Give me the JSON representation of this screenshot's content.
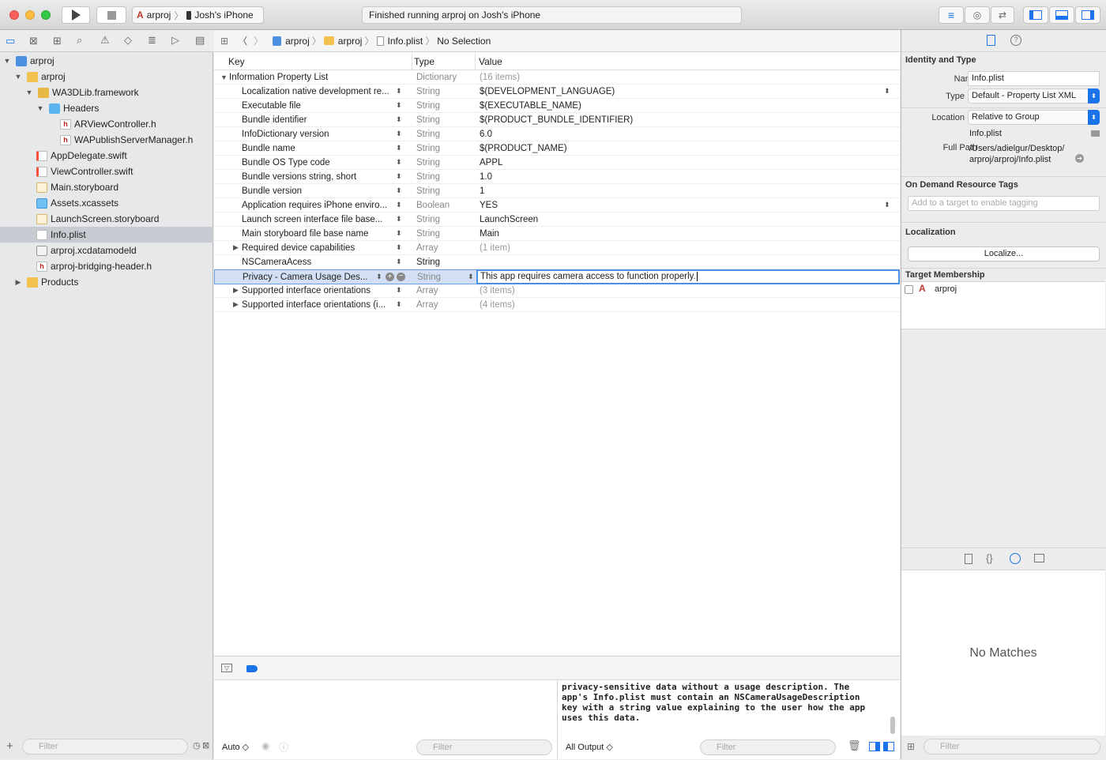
{
  "window": {
    "scheme_app": "arproj",
    "scheme_device": "Josh's iPhone",
    "status": "Finished running arproj on Josh's iPhone"
  },
  "navigator": {
    "items": [
      {
        "label": "arproj",
        "icon": "project-icon"
      },
      {
        "label": "arproj",
        "icon": "folder-icon"
      },
      {
        "label": "WA3DLib.framework",
        "icon": "framework-icon"
      },
      {
        "label": "Headers",
        "icon": "folder-icon"
      },
      {
        "label": "ARViewController.h",
        "icon": "header-file-icon"
      },
      {
        "label": "WAPublishServerManager.h",
        "icon": "header-file-icon"
      },
      {
        "label": "AppDelegate.swift",
        "icon": "swift-file-icon"
      },
      {
        "label": "ViewController.swift",
        "icon": "swift-file-icon"
      },
      {
        "label": "Main.storyboard",
        "icon": "storyboard-icon"
      },
      {
        "label": "Assets.xcassets",
        "icon": "assets-icon"
      },
      {
        "label": "LaunchScreen.storyboard",
        "icon": "storyboard-icon"
      },
      {
        "label": "Info.plist",
        "icon": "plist-icon"
      },
      {
        "label": "arproj.xcdatamodeld",
        "icon": "datamodel-icon"
      },
      {
        "label": "arproj-bridging-header.h",
        "icon": "header-file-icon"
      },
      {
        "label": "Products",
        "icon": "folder-icon"
      }
    ],
    "filter_placeholder": "Filter"
  },
  "jumpbar": {
    "p1": "arproj",
    "p2": "arproj",
    "p3": "Info.plist",
    "p4": "No Selection"
  },
  "plist": {
    "col_key": "Key",
    "col_type": "Type",
    "col_value": "Value",
    "root": {
      "key": "Information Property List",
      "type": "Dictionary",
      "value": "(16 items)"
    },
    "rows": [
      {
        "key": "Localization native development re...",
        "type": "String",
        "value": "$(DEVELOPMENT_LANGUAGE)"
      },
      {
        "key": "Executable file",
        "type": "String",
        "value": "$(EXECUTABLE_NAME)"
      },
      {
        "key": "Bundle identifier",
        "type": "String",
        "value": "$(PRODUCT_BUNDLE_IDENTIFIER)"
      },
      {
        "key": "InfoDictionary version",
        "type": "String",
        "value": "6.0"
      },
      {
        "key": "Bundle name",
        "type": "String",
        "value": "$(PRODUCT_NAME)"
      },
      {
        "key": "Bundle OS Type code",
        "type": "String",
        "value": "APPL"
      },
      {
        "key": "Bundle versions string, short",
        "type": "String",
        "value": "1.0"
      },
      {
        "key": "Bundle version",
        "type": "String",
        "value": "1"
      },
      {
        "key": "Application requires iPhone enviro...",
        "type": "Boolean",
        "value": "YES"
      },
      {
        "key": "Launch screen interface file base...",
        "type": "String",
        "value": "LaunchScreen"
      },
      {
        "key": "Main storyboard file base name",
        "type": "String",
        "value": "Main"
      },
      {
        "key": "Required device capabilities",
        "type": "Array",
        "value": "(1 item)"
      },
      {
        "key": "NSCameraAcess",
        "type": "String",
        "value": ""
      },
      {
        "key": "Privacy - Camera Usage Des...",
        "type": "String",
        "value": "This app requires camera access to function properly."
      },
      {
        "key": "Supported interface orientations",
        "type": "Array",
        "value": "(3 items)"
      },
      {
        "key": "Supported interface orientations (i...",
        "type": "Array",
        "value": "(4 items)"
      }
    ]
  },
  "debug": {
    "auto": "Auto ◇",
    "all_output": "All Output ◇",
    "filter": "Filter",
    "console_lines": [
      "privacy-sensitive data without a usage description.  The",
      "app's Info.plist must contain an NSCameraUsageDescription",
      "key with a string value explaining to the user how the app",
      "uses this data."
    ]
  },
  "inspector": {
    "identity_title": "Identity and Type",
    "name_label": "Name",
    "name_value": "Info.plist",
    "type_label": "Type",
    "type_value": "Default - Property List XML",
    "location_label": "Location",
    "location_value": "Relative to Group",
    "location_file": "Info.plist",
    "fullpath_label": "Full Path",
    "fullpath_1": "/Users/adielgur/Desktop/",
    "fullpath_2": "arproj/arproj/Info.plist",
    "odr_title": "On Demand Resource Tags",
    "odr_placeholder": "Add to a target to enable tagging",
    "loc_title": "Localization",
    "localize_btn": "Localize...",
    "tm_title": "Target Membership",
    "tm_target": "arproj",
    "no_matches": "No Matches",
    "filter": "Filter"
  }
}
